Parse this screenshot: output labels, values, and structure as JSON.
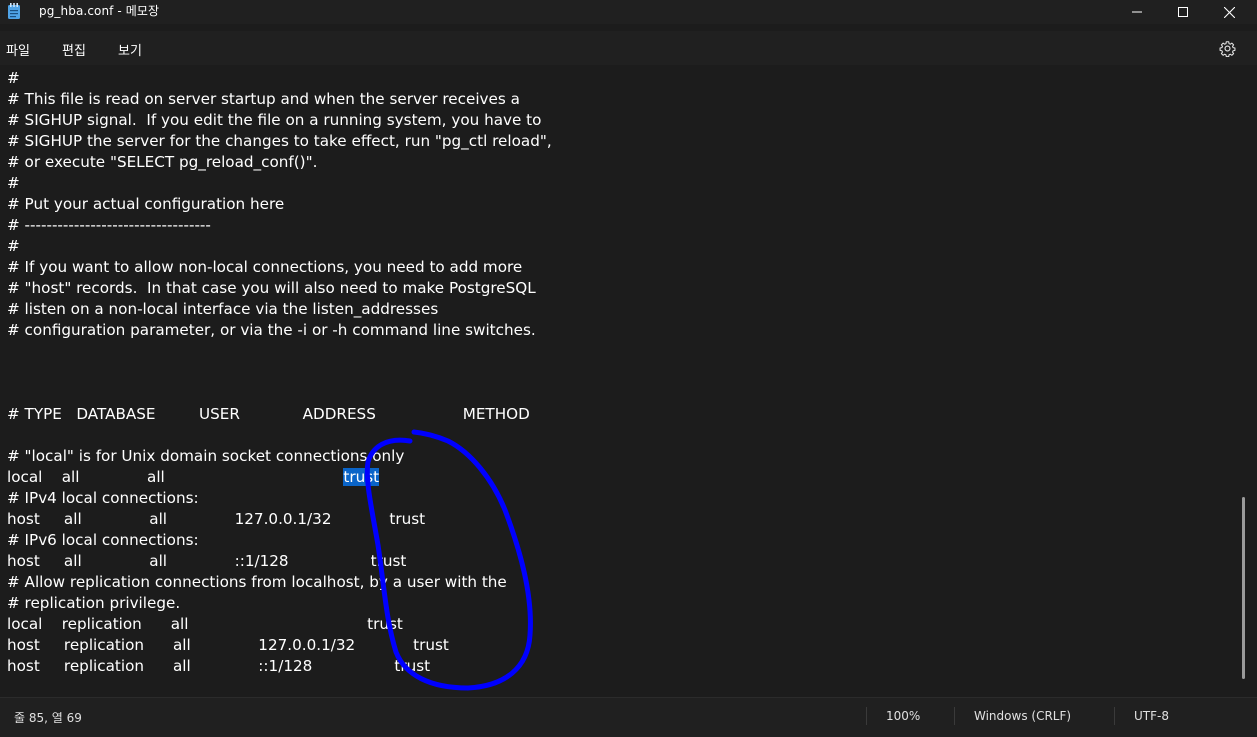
{
  "window": {
    "title": "pg_hba.conf - 메모장",
    "minimize_icon": "minimize-icon",
    "maximize_icon": "maximize-icon",
    "close_icon": "close-icon"
  },
  "menu": {
    "file": "파일",
    "edit": "편집",
    "view": "보기",
    "settings_icon": "gear-icon"
  },
  "editor": {
    "lines": [
      "#",
      "# This file is read on server startup and when the server receives a",
      "# SIGHUP signal.  If you edit the file on a running system, you have to",
      "# SIGHUP the server for the changes to take effect, run \"pg_ctl reload\",",
      "# or execute \"SELECT pg_reload_conf()\".",
      "#",
      "# Put your actual configuration here",
      "# ----------------------------------",
      "#",
      "# If you want to allow non-local connections, you need to add more",
      "# \"host\" records.  In that case you will also need to make PostgreSQL",
      "# listen on a non-local interface via the listen_addresses",
      "# configuration parameter, or via the -i or -h command line switches.",
      "",
      "",
      "",
      "# TYPE   DATABASE         USER             ADDRESS                  METHOD",
      "",
      "# \"local\" is for Unix domain socket connections only",
      "local    all              all                                     ",
      "# IPv4 local connections:",
      "host     all              all              127.0.0.1/32            trust",
      "# IPv6 local connections:",
      "host     all              all              ::1/128                 trust",
      "# Allow replication connections from localhost, by a user with the",
      "# replication privilege.",
      "local    replication      all                                     trust",
      "host     replication      all              127.0.0.1/32            trust",
      "host     replication      all              ::1/128                 trust"
    ],
    "selected_text": "trust",
    "annotation_color": "#0000ff"
  },
  "status": {
    "position": "줄 85, 열 69",
    "zoom": "100%",
    "line_ending": "Windows (CRLF)",
    "encoding": "UTF-8"
  }
}
